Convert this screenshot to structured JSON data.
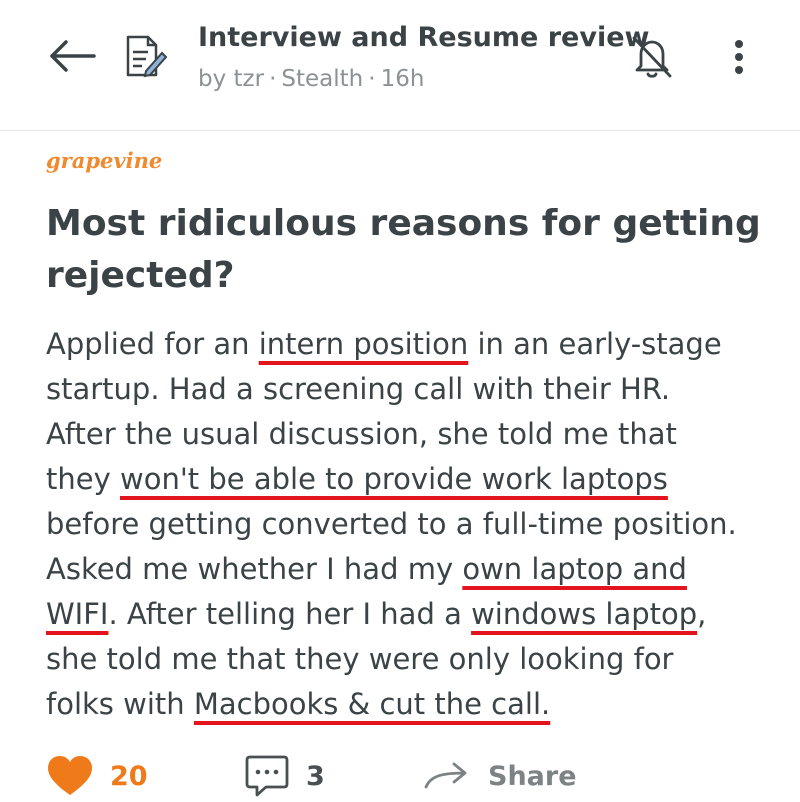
{
  "header": {
    "title": "Interview and Resume review",
    "author": "by tzr",
    "company": "Stealth",
    "time": "16h",
    "separator": "·",
    "icons": {
      "back": "arrow-left-icon",
      "channel": "document-edit-icon",
      "mute": "bell-off-icon",
      "menu": "more-vertical-icon"
    }
  },
  "post": {
    "tag": "grapevine",
    "title": "Most ridiculous reasons for getting rejected?",
    "body": {
      "l1_a": "Applied for an ",
      "l1_hl": "intern position",
      "l1_b": " in an early-stage",
      "l2": "startup. Had a screening call with their HR.",
      "l3": "After the usual discussion, she told me that",
      "l4_a": "they ",
      "l4_hl": "won't be able to provide work laptops",
      "l5": "before getting converted to a full-time position.",
      "l6_a": "Asked me whether I had my ",
      "l6_hl": "own laptop and",
      "l7_hl": "WIFI",
      "l7_a": ". After telling her I had a ",
      "l7_hl2": "windows laptop",
      "l7_b": ",",
      "l8": "she told me that they were only looking for",
      "l9_a": "folks with ",
      "l9_hl": "Macbooks & cut the call."
    },
    "highlight_color": "#e4141f"
  },
  "actions": {
    "likes": "20",
    "comments": "3",
    "share_label": "Share",
    "accent": "#ef7a1a"
  }
}
